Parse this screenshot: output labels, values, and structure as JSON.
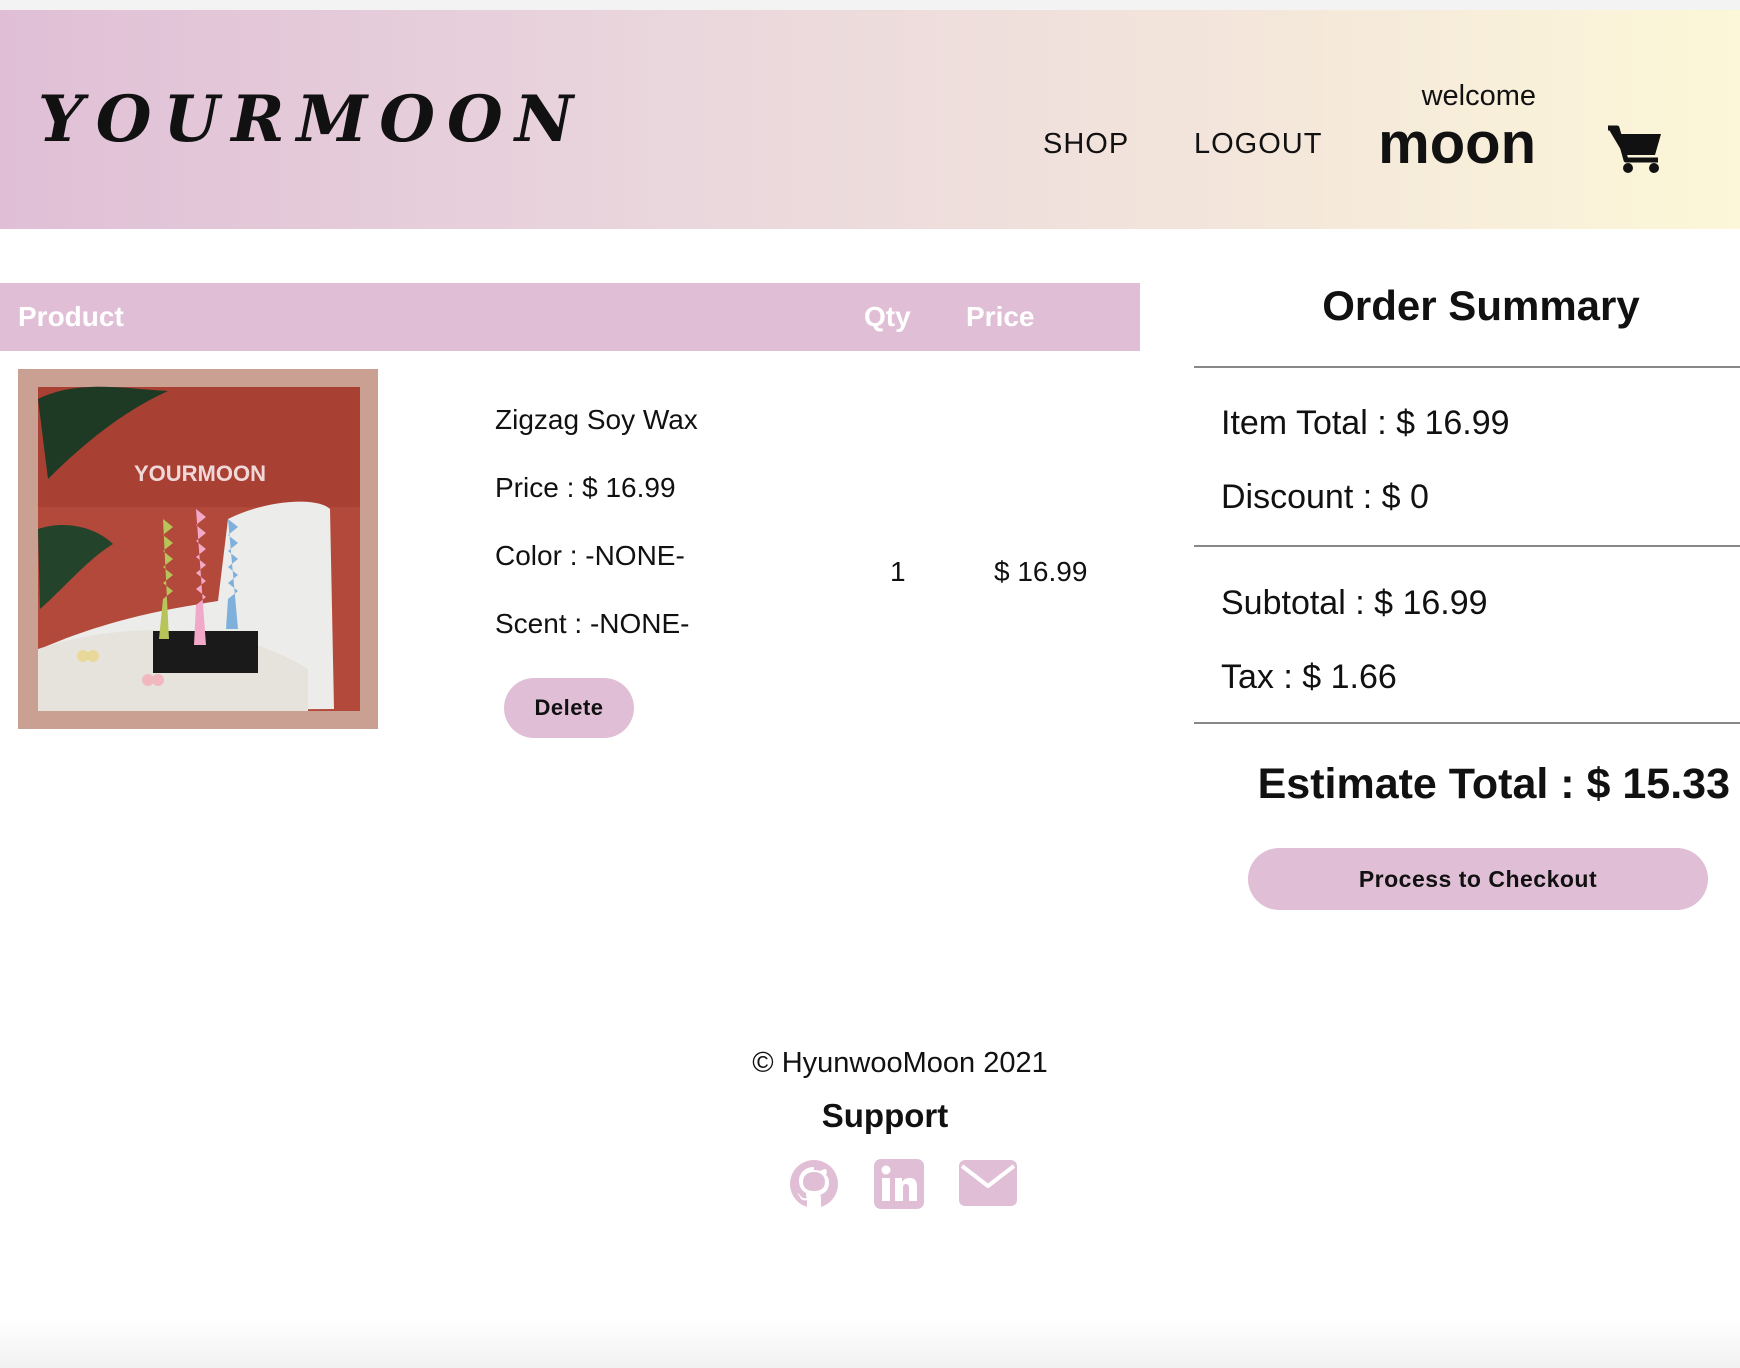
{
  "header": {
    "logo": "YOURMOON",
    "nav": {
      "shop": "SHOP",
      "logout": "LOGOUT"
    },
    "welcome": "welcome",
    "username": "moon",
    "cart_icon": "shopping-cart-icon"
  },
  "cart_table": {
    "columns": {
      "product": "Product",
      "qty": "Qty",
      "price": "Price"
    },
    "item": {
      "image_label": "YOURMOON",
      "name": "Zigzag Soy Wax",
      "price": "Price : $ 16.99",
      "color": "Color : -NONE-",
      "scent": "Scent : -NONE-",
      "delete_label": "Delete",
      "qty": "1",
      "line_price": "$ 16.99"
    }
  },
  "summary": {
    "title": "Order Summary",
    "item_total": "Item Total : $ 16.99",
    "discount": "Discount : $ 0",
    "subtotal": "Subtotal : $ 16.99",
    "tax": "Tax : $ 1.66",
    "estimate_total": "Estimate Total : $ 15.33",
    "checkout_label": "Process to Checkout"
  },
  "footer": {
    "copyright": "© HyunwooMoon 2021",
    "support": "Support",
    "icons": [
      "github-icon",
      "linkedin-icon",
      "mail-icon"
    ]
  },
  "colors": {
    "accent_pink": "#e0bfd6",
    "header_gradient_start": "#e0bfd6",
    "header_gradient_end": "#fcf7d8"
  }
}
